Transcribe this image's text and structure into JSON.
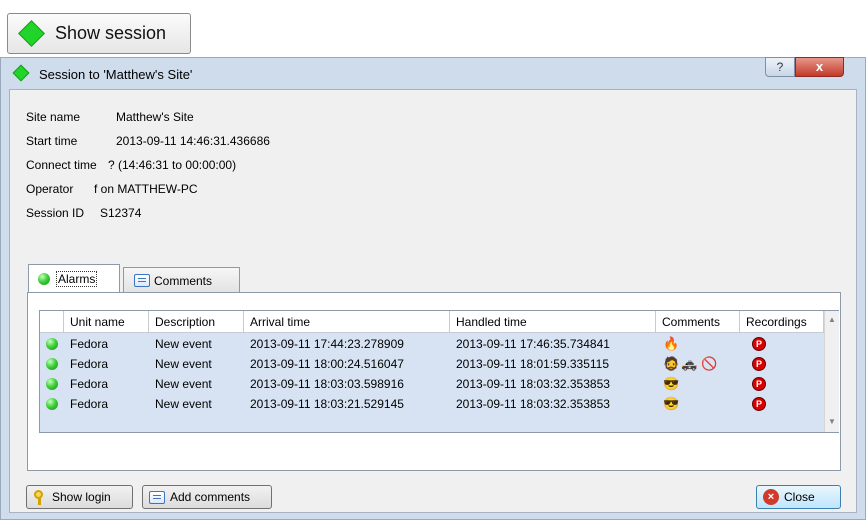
{
  "top_button": {
    "label": "Show session",
    "icon": "green-diamond-icon"
  },
  "window": {
    "title": "Session to 'Matthew's Site'",
    "help_label": "?",
    "close_label": "x"
  },
  "info": [
    {
      "label": "Site name",
      "value": "Matthew's Site"
    },
    {
      "label": "Start time",
      "value": "2013-09-11 14:46:31.436686"
    },
    {
      "label": "Connect time",
      "value": "? (14:46:31 to 00:00:00)"
    },
    {
      "label": "Operator",
      "value": "f on MATTHEW-PC"
    },
    {
      "label": "Session ID",
      "value": "S12374"
    }
  ],
  "tabs": [
    {
      "label": "Alarms",
      "selected": true
    },
    {
      "label": "Comments",
      "selected": false
    }
  ],
  "grid": {
    "columns": [
      "Unit name",
      "Description",
      "Arrival time",
      "Handled time",
      "Comments",
      "Recordings"
    ],
    "rows": [
      {
        "unit": "Fedora",
        "description": "New event",
        "arrival": "2013-09-11 17:44:23.278909",
        "handled": "2013-09-11 17:46:35.734841",
        "comments": [
          "fire-icon"
        ],
        "recording": "recording-icon"
      },
      {
        "unit": "Fedora",
        "description": "New event",
        "arrival": "2013-09-11 18:00:24.516047",
        "handled": "2013-09-11 18:01:59.335115",
        "comments": [
          "person-icon",
          "police-car-icon",
          "no-vehicle-icon"
        ],
        "recording": "recording-icon"
      },
      {
        "unit": "Fedora",
        "description": "New event",
        "arrival": "2013-09-11 18:03:03.598916",
        "handled": "2013-09-11 18:03:32.353853",
        "comments": [
          "face-icon"
        ],
        "recording": "recording-icon"
      },
      {
        "unit": "Fedora",
        "description": "New event",
        "arrival": "2013-09-11 18:03:21.529145",
        "handled": "2013-09-11 18:03:32.353853",
        "comments": [
          "face-icon"
        ],
        "recording": "recording-icon"
      }
    ]
  },
  "buttons": {
    "show_login": "Show login",
    "add_comments": "Add comments",
    "close": "Close"
  },
  "colors": {
    "status_green": "#22d429",
    "grid_selection": "#d7e3f2",
    "recording_red": "#d80000"
  }
}
